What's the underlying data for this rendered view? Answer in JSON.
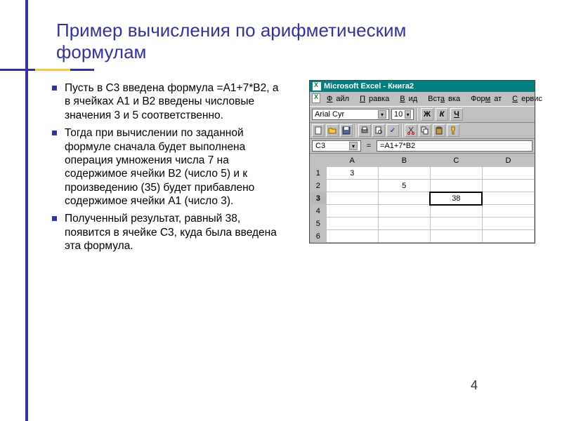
{
  "slide": {
    "title": "Пример вычисления по арифметическим формулам",
    "page_number": "4",
    "bullets": [
      "Пусть в C3 введена формула =A1+7*B2, а в ячейках A1 и B2 введены числовые значения 3 и 5 соответственно.",
      "Тогда при вычислении по заданной формуле сначала будет выполнена операция умножения числа 7 на содержимое ячейки B2 (число 5) и к произведению (35) будет прибавлено содержимое ячейки A1 (число 3).",
      "Полученный результат, равный 38, появится в ячейке C3, куда была введена эта формула."
    ]
  },
  "excel": {
    "title": "Microsoft Excel - Книга2",
    "menu": {
      "file": "Файл",
      "edit": "Правка",
      "view": "Вид",
      "insert": "Вставка",
      "format": "Формат",
      "service": "Сервис"
    },
    "font": {
      "name": "Arial Cyr",
      "size": "10"
    },
    "format_buttons": {
      "bold": "Ж",
      "italic": "К",
      "underline": "Ч"
    },
    "name_box": "C3",
    "formula": "=A1+7*B2",
    "columns": [
      "A",
      "B",
      "C",
      "D"
    ],
    "rows": [
      "1",
      "2",
      "3",
      "4",
      "5",
      "6"
    ],
    "cells": {
      "A1": "3",
      "B2": "5",
      "C3": "38"
    },
    "active_cell": "C3",
    "fx_label": "="
  }
}
